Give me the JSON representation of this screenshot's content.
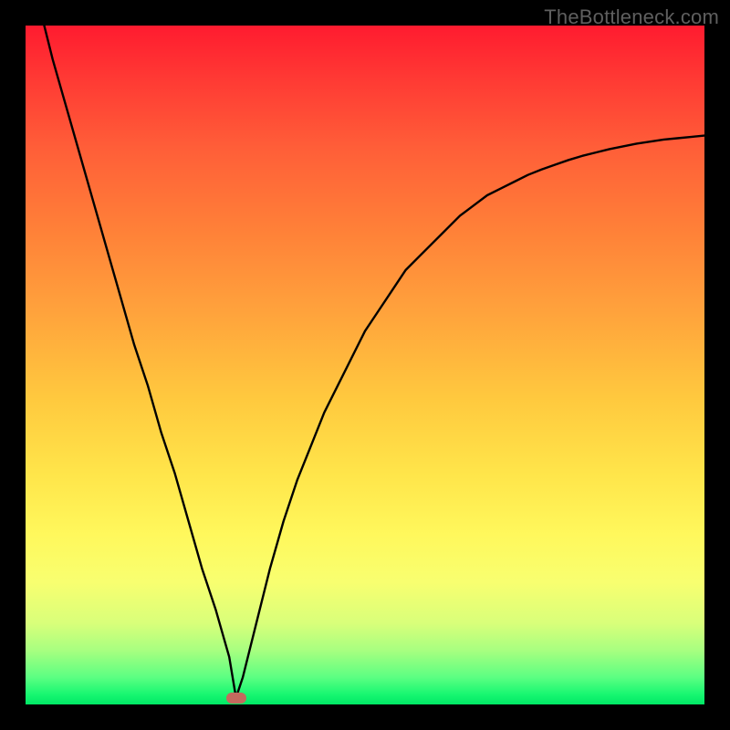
{
  "watermark": "TheBottleneck.com",
  "colors": {
    "curve_stroke": "#000000",
    "marker_fill": "#c46a5e",
    "frame_bg": "#000000"
  },
  "chart_data": {
    "type": "line",
    "title": "",
    "xlabel": "",
    "ylabel": "",
    "xlim": [
      0,
      100
    ],
    "ylim": [
      0,
      100
    ],
    "grid": false,
    "legend": false,
    "minimum_x": 31,
    "series": [
      {
        "name": "bottleneck-curve",
        "x": [
          0,
          2,
          4,
          6,
          8,
          10,
          12,
          14,
          16,
          18,
          20,
          22,
          24,
          26,
          28,
          30,
          31,
          32,
          34,
          36,
          38,
          40,
          42,
          44,
          46,
          48,
          50,
          52,
          54,
          56,
          58,
          60,
          62,
          64,
          66,
          68,
          70,
          72,
          74,
          76,
          78,
          80,
          82,
          84,
          86,
          88,
          90,
          92,
          94,
          96,
          98,
          100
        ],
        "values": [
          112,
          103,
          95,
          88,
          81,
          74,
          67,
          60,
          53,
          47,
          40,
          34,
          27,
          20,
          14,
          7,
          1,
          4,
          12,
          20,
          27,
          33,
          38,
          43,
          47,
          51,
          55,
          58,
          61,
          64,
          66,
          68,
          70,
          72,
          73.5,
          75,
          76,
          77,
          78,
          78.8,
          79.5,
          80.2,
          80.8,
          81.3,
          81.8,
          82.2,
          82.6,
          82.9,
          83.2,
          83.4,
          83.6,
          83.8
        ]
      }
    ]
  }
}
